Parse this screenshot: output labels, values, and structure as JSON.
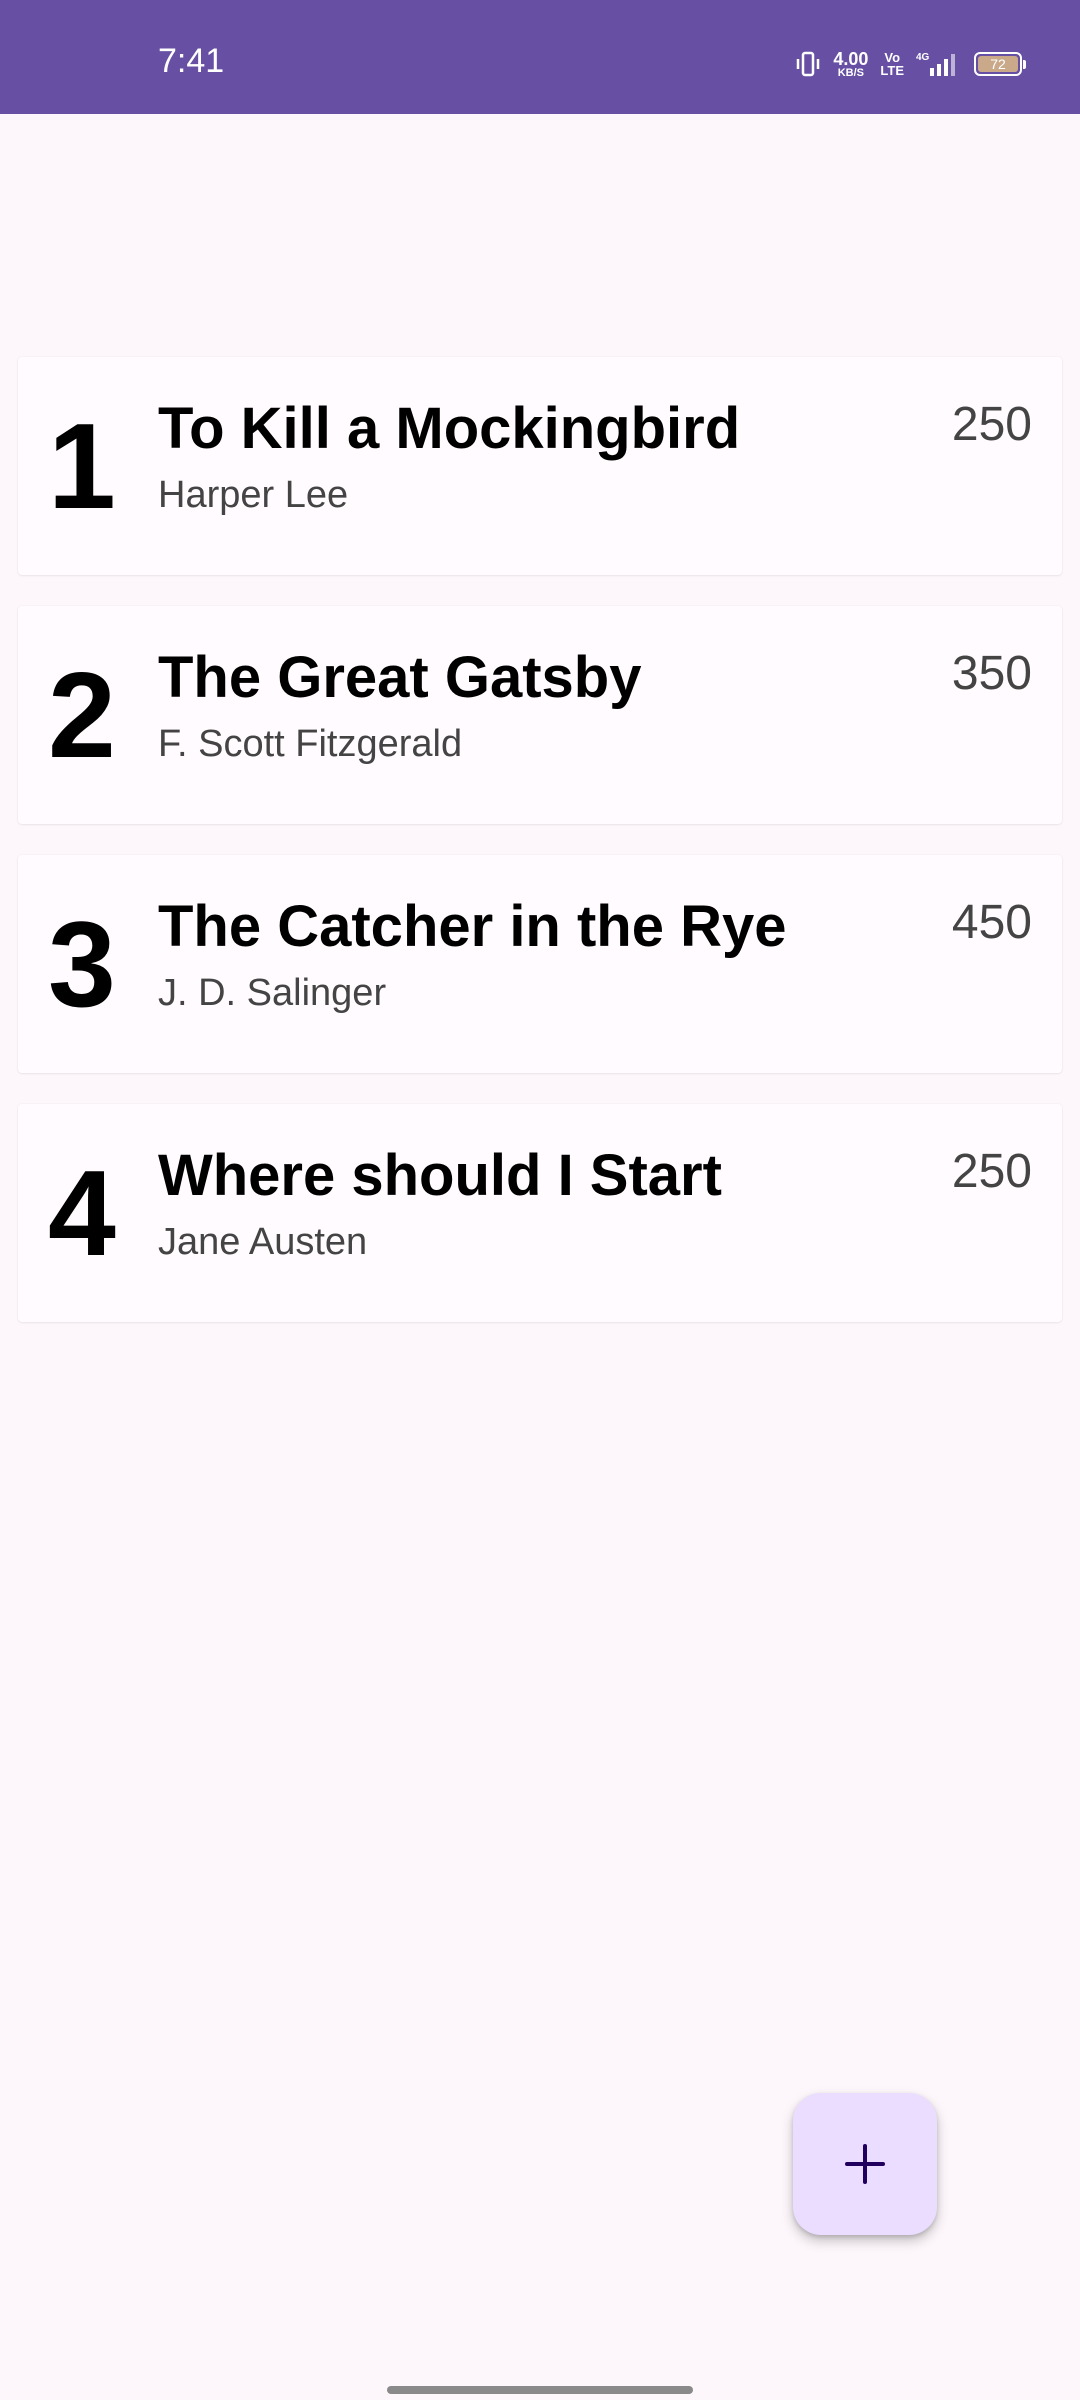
{
  "status_bar": {
    "time": "7:41",
    "net_speed_value": "4.00",
    "net_speed_unit": "KB/S",
    "volte_top": "Vo",
    "volte_bottom": "LTE",
    "network": "4G",
    "battery_level": "72",
    "icons": [
      "vibrate-icon",
      "signal-icon",
      "battery-icon"
    ],
    "background_color": "#6750a4"
  },
  "books": [
    {
      "rank": "1",
      "title": "To Kill a Mockingbird",
      "author": "Harper Lee",
      "pages": "250"
    },
    {
      "rank": "2",
      "title": "The Great Gatsby",
      "author": "F. Scott Fitzgerald",
      "pages": "350"
    },
    {
      "rank": "3",
      "title": "The Catcher in the Rye",
      "author": "J. D. Salinger",
      "pages": "450"
    },
    {
      "rank": "4",
      "title": "Where should I Start",
      "author": "Jane Austen",
      "pages": "250"
    }
  ],
  "fab": {
    "icon": "plus-icon",
    "background_color": "#eaddff"
  },
  "colors": {
    "background": "#fdf7fb",
    "card": "#fffbfe",
    "primary": "#6750a4"
  }
}
